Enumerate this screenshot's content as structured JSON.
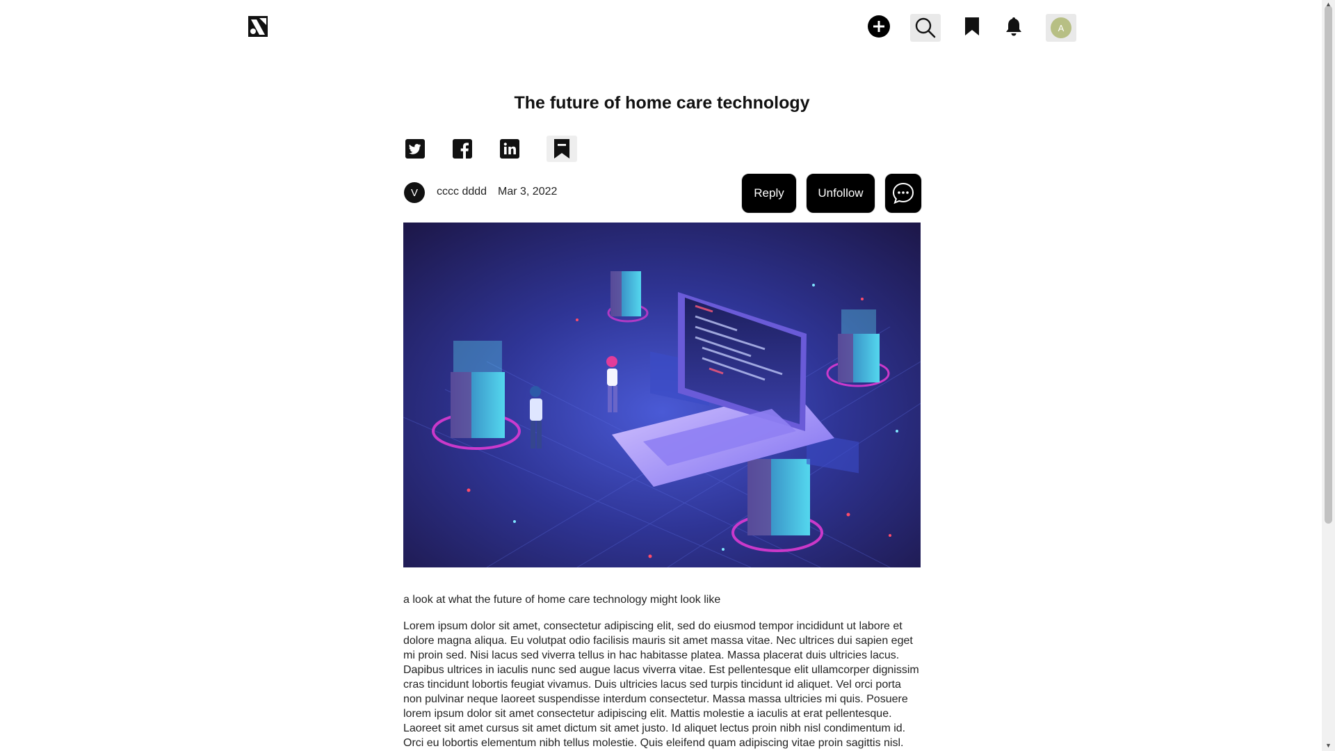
{
  "header": {
    "user_initial": "A"
  },
  "article": {
    "title": "The future of home care technology",
    "author_initial": "V",
    "author_name": "cccc dddd",
    "date": "Mar 3, 2022",
    "reply_label": "Reply",
    "unfollow_label": "Unfollow",
    "subtitle": "a look at what the future of home care technology might look like",
    "body": "Lorem ipsum dolor sit amet, consectetur adipiscing elit, sed do eiusmod tempor incididunt ut labore et dolore magna aliqua. Eu volutpat odio facilisis mauris sit amet massa vitae. Nec ultrices dui sapien eget mi proin sed. Nisi lacus sed viverra tellus in hac habitasse platea. Massa placerat duis ultricies lacus. Dapibus ultrices in iaculis nunc sed augue lacus viverra vitae. Est pellentesque elit ullamcorper dignissim cras tincidunt lobortis feugiat vivamus. Duis ultricies lacus sed turpis tincidunt id aliquet. Vel orci porta non pulvinar neque laoreet suspendisse interdum consectetur. Massa massa ultricies mi quis. Posuere lorem ipsum dolor sit amet consectetur adipiscing elit. Mattis molestie a iaculis at erat pellentesque. Laoreet sit amet cursus sit amet dictum sit amet justo. Id aliquet lectus proin nibh nisl condimentum id. Orci eu lobortis elementum nibh tellus molestie. Quis eleifend quam adipiscing vitae proin sagittis nisl."
  },
  "icons": {
    "logo": "site-logo",
    "add": "plus-circle-icon",
    "search": "search-icon",
    "bookmarks": "bookmark-icon",
    "notifications": "bell-icon",
    "share": [
      "twitter-icon",
      "facebook-icon",
      "linkedin-icon",
      "bookmark-icon"
    ],
    "chat": "chat-bubble-icon"
  },
  "colors": {
    "accent": "#000000",
    "avatar_bg": "#b7bf84",
    "hero_bg": "#2a2a7a"
  }
}
